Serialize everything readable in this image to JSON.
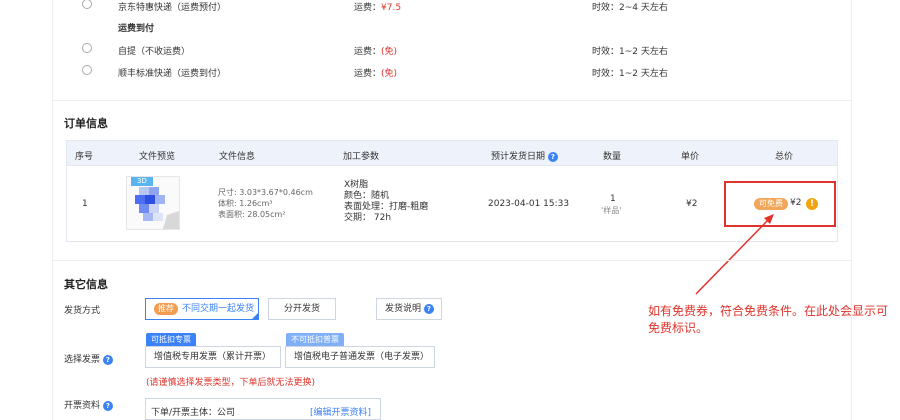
{
  "shipping": {
    "options": [
      {
        "name": "京东特惠快递（运费预付）",
        "fee_label": "运费：",
        "fee_value": "¥7.5",
        "time": "时效：2~4 天左右"
      },
      {
        "name": "自提（不收运费）",
        "fee_label": "运费：",
        "fee_value": "(免)",
        "time": "时效：1~2 天左右"
      },
      {
        "name": "顺丰标准快递（运费到付）",
        "fee_label": "运费：",
        "fee_value": "(免)",
        "time": "时效：1~2 天左右"
      }
    ],
    "group_title": "运费到付"
  },
  "order": {
    "title": "订单信息",
    "columns": [
      "序号",
      "文件预览",
      "文件信息",
      "加工参数",
      "预计发货日期",
      "数量",
      "单价",
      "总价"
    ],
    "row": {
      "index": "1",
      "preview_tag": "3D",
      "file_info": [
        "尺寸: 3.03*3.67*0.46cm",
        "体积: 1.26cm³",
        "表面积: 28.05cm²"
      ],
      "params": [
        "X树脂",
        "颜色：随机",
        "表面处理：打磨-粗磨",
        "交期： 72h"
      ],
      "ship_date": "2023-04-01 15:33",
      "qty": "1",
      "qty_note": "'样品'",
      "unit_price": "¥2",
      "total_badge": "可免费",
      "total_price": "¥2",
      "total_warn": "!"
    }
  },
  "other": {
    "title": "其它信息",
    "ship_method_label": "发货方式",
    "ship_recommend_tag": "推荐",
    "ship_together": "不同交期一起发货",
    "ship_separate": "分开发货",
    "ship_help": "发货说明",
    "invoice_label": "选择发票",
    "invoice_tag_special": "可抵扣专票",
    "invoice_special": "增值税专用发票（累计开票）",
    "invoice_tag_normal": "不可抵扣普票",
    "invoice_normal": "增值税电子普通发票（电子发票）",
    "invoice_warning": "(请谨慎选择发票类型，下单后就无法更换)",
    "invoice_info_label": "开票资料",
    "invoice_subject": "下单/开票主体：公司",
    "invoice_edit": "[编辑开票资料]"
  },
  "annotation": "如有免费券，符合免费条件。在此处会显示可免费标识。",
  "colors": {
    "accent": "#3b82f6",
    "red": "#e0332b",
    "badge": "#f2a65a"
  }
}
